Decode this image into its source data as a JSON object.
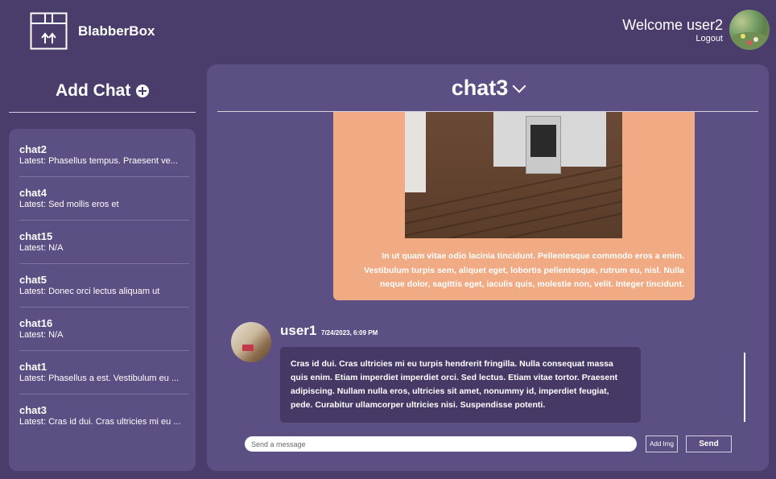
{
  "header": {
    "brand": "BlabberBox",
    "welcome": "Welcome user2",
    "logout": "Logout",
    "logo_icon": "box-upload-icon",
    "avatar_icon": "user-avatar"
  },
  "sidebar": {
    "add_chat_label": "Add Chat",
    "add_icon": "plus-circle-icon",
    "chats": [
      {
        "name": "chat2",
        "latest": "Latest: Phasellus tempus. Praesent ve..."
      },
      {
        "name": "chat4",
        "latest": "Latest: Sed mollis eros et"
      },
      {
        "name": "chat15",
        "latest": "Latest: N/A"
      },
      {
        "name": "chat5",
        "latest": "Latest: Donec orci lectus aliquam ut"
      },
      {
        "name": "chat16",
        "latest": "Latest: N/A"
      },
      {
        "name": "chat1",
        "latest": "Latest: Phasellus a est. Vestibulum eu ..."
      },
      {
        "name": "chat3",
        "latest": "Latest: Cras id dui. Cras ultricies mi eu ..."
      }
    ]
  },
  "main": {
    "chat_title": "chat3",
    "chevron_icon": "chevron-down-icon",
    "image_message": {
      "text": "In ut quam vitae odio lacinia tincidunt. Pellentesque commodo eros a enim. Vestibulum turpis sem, aliquet eget, lobortis pellentesque, rutrum eu, nisl. Nulla neque dolor, sagittis eget, iaculis quis, molestie non, velit. Integer tincidunt.",
      "card_color": "#f0ab84"
    },
    "message": {
      "author": "user1",
      "timestamp": "7/24/2023, 6:09 PM",
      "text": "Cras id dui. Cras ultricies mi eu turpis hendrerit fringilla. Nulla consequat massa quis enim. Etiam imperdiet imperdiet orci. Sed lectus. Etiam vitae tortor. Praesent adipiscing. Nullam nulla eros, ultricies sit amet, nonummy id, imperdiet feugiat, pede. Curabitur ullamcorper ultricies nisi. Suspendisse potenti."
    },
    "composer": {
      "placeholder": "Send a message",
      "add_img_label": "Add Img",
      "send_label": "Send"
    }
  },
  "colors": {
    "background": "#4a3d6b",
    "panel": "#5c4f84",
    "bubble": "#463966",
    "accent_card": "#f0ab84"
  }
}
